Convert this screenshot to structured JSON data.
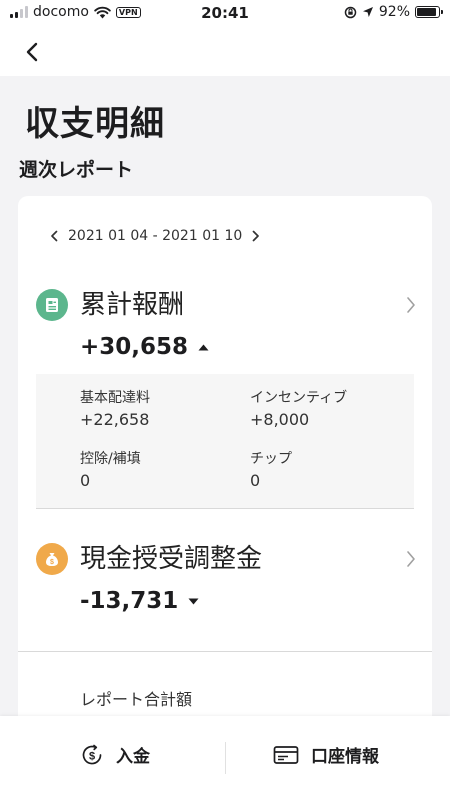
{
  "status_bar": {
    "carrier": "docomo",
    "vpn": "VPN",
    "time": "20:41",
    "battery": "92%",
    "battery_level": 0.92
  },
  "nav": {
    "back_icon": "chevron-left-icon"
  },
  "page": {
    "title": "収支明細",
    "section_title": "週次レポート"
  },
  "report": {
    "date_range": "2021 01 04 - 2021 01 10",
    "cumulative": {
      "label": "累計報酬",
      "value": "+30,658",
      "icon": "receipt-icon",
      "icon_color": "#5cb68d",
      "trend": "up"
    },
    "breakdown": {
      "base_fee_label": "基本配達料",
      "base_fee_value": "+22,658",
      "incentive_label": "インセンティブ",
      "incentive_value": "+8,000",
      "deduction_label": "控除/補填",
      "deduction_value": "0",
      "tip_label": "チップ",
      "tip_value": "0"
    },
    "cash": {
      "label": "現金授受調整金",
      "value": "-13,731",
      "icon": "money-bag-icon",
      "icon_color": "#f0a94a",
      "trend": "down"
    },
    "total_label": "レポート合計額"
  },
  "bottom_bar": {
    "deposit_label": "入金",
    "account_label": "口座情報"
  }
}
